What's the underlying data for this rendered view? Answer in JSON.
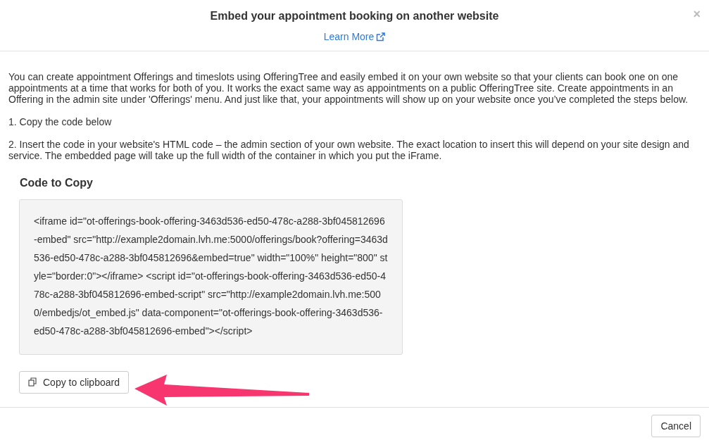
{
  "dialog": {
    "title": "Embed your appointment booking on another website",
    "close": "×",
    "learn_more": "Learn More"
  },
  "intro": "You can create appointment Offerings and timeslots using OfferingTree and easily embed it on your own website so that your clients can book one on one appointments at a time that works for both of you. It works the exact same way as appointments on a public OfferingTree site. Create appointments in an Offering in the admin site under 'Offerings' menu. And just like that, your appointments will show up on your website once you’ve completed the steps below.",
  "steps": [
    "1. Copy the code below",
    "2. Insert the code in your website's HTML code – the admin section of your own website. The exact location to insert this will depend on your site design and service. The embedded page will take up the full width of the container in which you put the iFrame."
  ],
  "code_section": {
    "heading": "Code to Copy",
    "code": "<iframe id=\"ot-offerings-book-offering-3463d536-ed50-478c-a288-3bf045812696-embed\" src=\"http://example2domain.lvh.me:5000/offerings/book?offering=3463d536-ed50-478c-a288-3bf045812696&embed=true\" width=\"100%\" height=\"800\" style=\"border:0\"></iframe> <script id=\"ot-offerings-book-offering-3463d536-ed50-478c-a288-3bf045812696-embed-script\" src=\"http://example2domain.lvh.me:5000/embedjs/ot_embed.js\" data-component=\"ot-offerings-book-offering-3463d536-ed50-478c-a288-3bf045812696-embed\"></script>",
    "copy_button": "Copy to clipboard"
  },
  "footer": {
    "cancel": "Cancel"
  }
}
